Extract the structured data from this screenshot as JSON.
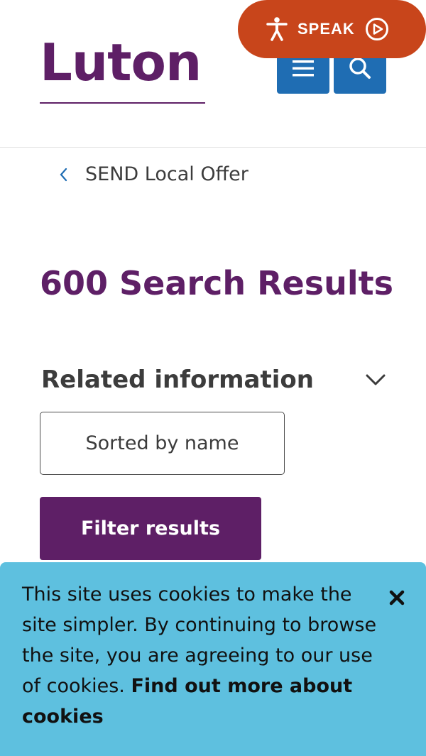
{
  "header": {
    "logo_text": "Luton",
    "menu_icon": "hamburger-icon",
    "search_icon": "search-icon",
    "speak_label": "SPEAK",
    "speak_icons": [
      "accessibility-person-icon",
      "play-circle-icon"
    ],
    "brand_color": "#5e1f66",
    "button_color": "#1f6db3",
    "speak_color": "#c8451b"
  },
  "breadcrumb": {
    "back_icon": "chevron-left-icon",
    "label": "SEND Local Offer"
  },
  "main": {
    "title": "600 Search Results",
    "related_label": "Related information",
    "related_icon": "chevron-down-icon",
    "sort_label": "Sorted by name",
    "filter_label": "Filter results"
  },
  "cookie_banner": {
    "text": "This site uses cookies to make the site simpler. By continuing to browse the site, you are agreeing to our use of cookies. ",
    "link_text": "Find out more about cookies",
    "close_icon": "close-icon",
    "background": "#5ec0df"
  }
}
